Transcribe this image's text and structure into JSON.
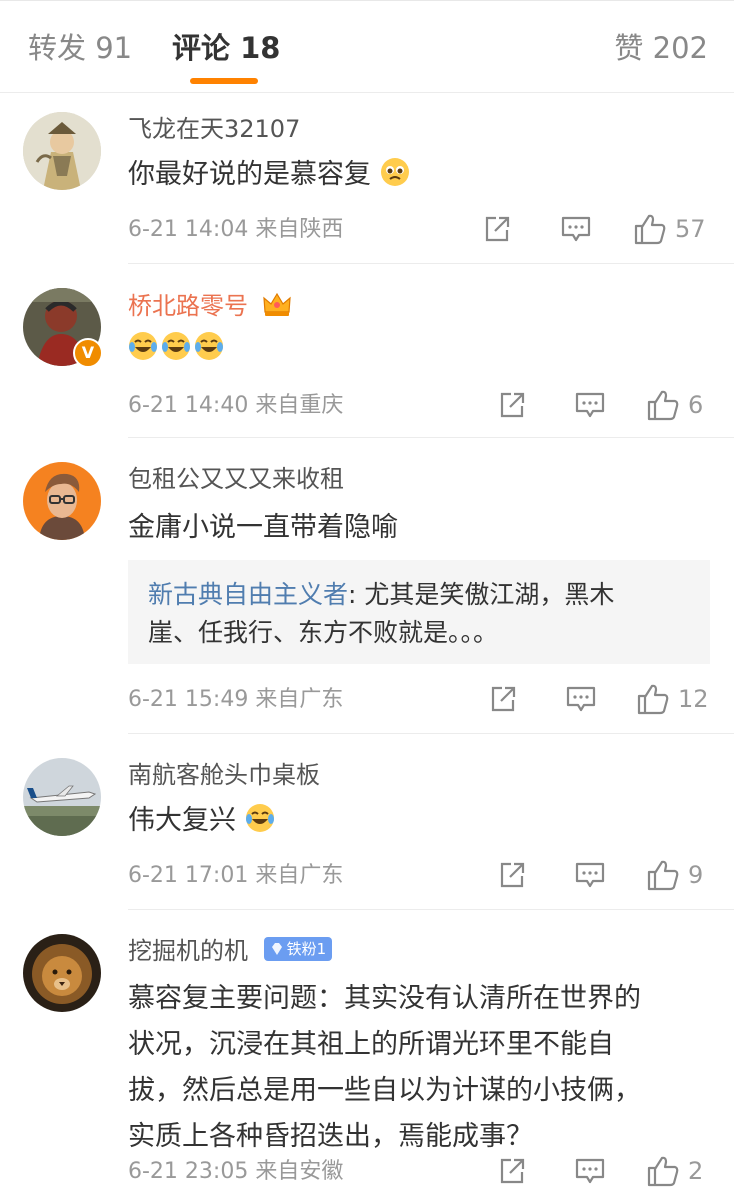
{
  "tabs": {
    "repost": "转发 91",
    "comments": "评论 18",
    "likes": "赞 202"
  },
  "comments": [
    {
      "username": "飞龙在天32107",
      "text": "你最好说的是慕容复",
      "emoji": "pleading-face",
      "time": "6-21 14:04",
      "location": "来自陕西",
      "likes": "57"
    },
    {
      "username": "桥北路零号",
      "emoji": "laughing-crying-face x3",
      "time": "6-21 14:40",
      "location": "来自重庆",
      "likes": "6",
      "badge_icon": "crown-icon",
      "verified_badge": "V"
    },
    {
      "username": "包租公又又又来收租",
      "text": "金庸小说一直带着隐喻",
      "reply_user": "新古典自由主义者",
      "reply_sep": ": ",
      "reply_line1": "尤其是笑傲江湖，黑木",
      "reply_line2": "崖、任我行、东方不败就是。。。",
      "time": "6-21 15:49",
      "location": "来自广东",
      "likes": "12"
    },
    {
      "username": "南航客舱头巾桌板",
      "text": "伟大复兴",
      "emoji": "laughing-crying-face",
      "time": "6-21 17:01",
      "location": "来自广东",
      "likes": "9"
    },
    {
      "username": "挖掘机的机",
      "fan_badge": "铁粉1",
      "text_lines": [
        "慕容复主要问题：其实没有认清所在世界的",
        "状况，沉浸在其祖上的所谓光环里不能自",
        "拔，然后总是用一些自以为计谋的小技俩，",
        "实质上各种昏招迭出，焉能成事？"
      ],
      "time": "6-21 23:05",
      "location": "来自安徽",
      "likes": "2"
    }
  ],
  "colors": {
    "accent": "#ff8200",
    "vip_name": "#eb7350",
    "link": "#507daf"
  }
}
